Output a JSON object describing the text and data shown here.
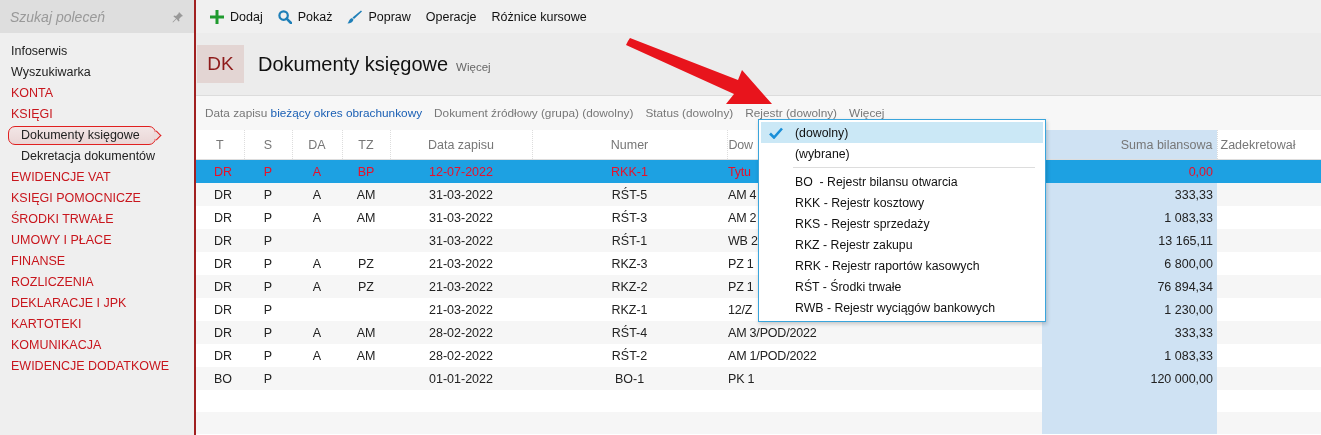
{
  "sidebar": {
    "search": {
      "placeholder": "Szukaj poleceń"
    },
    "items": [
      {
        "label": "Infoserwis",
        "kind": "link",
        "selected": false
      },
      {
        "label": "Wyszukiwarka",
        "kind": "link",
        "selected": false
      },
      {
        "label": "KONTA",
        "kind": "section",
        "selected": false
      },
      {
        "label": "KSIĘGI",
        "kind": "section",
        "selected": false
      },
      {
        "label": "Dokumenty księgowe",
        "kind": "subitem",
        "selected": true
      },
      {
        "label": "Dekretacja dokumentów",
        "kind": "subitem",
        "selected": false
      },
      {
        "label": "EWIDENCJE VAT",
        "kind": "section",
        "selected": false
      },
      {
        "label": "KSIĘGI POMOCNICZE",
        "kind": "section",
        "selected": false
      },
      {
        "label": "ŚRODKI TRWAŁE",
        "kind": "section",
        "selected": false
      },
      {
        "label": "UMOWY I PŁACE",
        "kind": "section",
        "selected": false
      },
      {
        "label": "FINANSE",
        "kind": "section",
        "selected": false
      },
      {
        "label": "ROZLICZENIA",
        "kind": "section",
        "selected": false
      },
      {
        "label": "DEKLARACJE I JPK",
        "kind": "section",
        "selected": false
      },
      {
        "label": "KARTOTEKI",
        "kind": "section",
        "selected": false
      },
      {
        "label": "KOMUNIKACJA",
        "kind": "section",
        "selected": false
      },
      {
        "label": "EWIDENCJE DODATKOWE",
        "kind": "section",
        "selected": false
      }
    ]
  },
  "toolbar": [
    {
      "label": "Dodaj"
    },
    {
      "label": "Pokaż"
    },
    {
      "label": "Popraw"
    },
    {
      "label": "Operacje"
    },
    {
      "label": "Różnice kursowe"
    }
  ],
  "header": {
    "badge": "DK",
    "title": "Dokumenty księgowe",
    "more": "Więcej"
  },
  "filters": [
    {
      "label": "Data zapisu",
      "value": "bieżący okres obrachunkowy"
    },
    {
      "label": "Dokument źródłowy (grupa) (dowolny)"
    },
    {
      "label": "Status (dowolny)"
    },
    {
      "label": "Rejestr (dowolny)"
    },
    {
      "label": "Więcej"
    }
  ],
  "table": {
    "columns": [
      "T",
      "S",
      "DA",
      "TZ",
      "Data zapisu",
      "Numer",
      "Dow",
      "Suma bilansowa",
      "Zadekretował"
    ],
    "rows": [
      {
        "cells": [
          "DR",
          "P",
          "A",
          "BP",
          "12-07-2022",
          "RKK-1",
          "Tytu",
          "0,00",
          ""
        ],
        "selected": true
      },
      {
        "cells": [
          "DR",
          "P",
          "A",
          "AM",
          "31-03-2022",
          "RŚT-5",
          "AM 4",
          "333,33",
          ""
        ],
        "selected": false
      },
      {
        "cells": [
          "DR",
          "P",
          "A",
          "AM",
          "31-03-2022",
          "RŚT-3",
          "AM 2",
          "1 083,33",
          ""
        ],
        "selected": false
      },
      {
        "cells": [
          "DR",
          "P",
          "",
          "",
          "31-03-2022",
          "RŚT-1",
          "WB 2",
          "13 165,11",
          ""
        ],
        "selected": false
      },
      {
        "cells": [
          "DR",
          "P",
          "A",
          "PZ",
          "21-03-2022",
          "RKZ-3",
          "PZ 1",
          "6 800,00",
          ""
        ],
        "selected": false
      },
      {
        "cells": [
          "DR",
          "P",
          "A",
          "PZ",
          "21-03-2022",
          "RKZ-2",
          "PZ 1",
          "76 894,34",
          ""
        ],
        "selected": false
      },
      {
        "cells": [
          "DR",
          "P",
          "",
          "",
          "21-03-2022",
          "RKZ-1",
          "12/Z",
          "1 230,00",
          ""
        ],
        "selected": false
      },
      {
        "cells": [
          "DR",
          "P",
          "A",
          "AM",
          "28-02-2022",
          "RŚT-4",
          "AM 3/POD/2022",
          "333,33",
          ""
        ],
        "selected": false
      },
      {
        "cells": [
          "DR",
          "P",
          "A",
          "AM",
          "28-02-2022",
          "RŚT-2",
          "AM 1/POD/2022",
          "1 083,33",
          ""
        ],
        "selected": false
      },
      {
        "cells": [
          "BO",
          "P",
          "",
          "",
          "01-01-2022",
          "BO-1",
          "PK 1",
          "120 000,00",
          ""
        ],
        "selected": false
      }
    ]
  },
  "dropdown": {
    "items": [
      {
        "kind": "option",
        "label": "(dowolny)",
        "selected": true
      },
      {
        "kind": "option",
        "label": "(wybrane)",
        "selected": false
      },
      {
        "kind": "divider"
      },
      {
        "kind": "option",
        "label": "BO  - Rejestr bilansu otwarcia",
        "selected": false
      },
      {
        "kind": "option",
        "label": "RKK - Rejestr kosztowy",
        "selected": false
      },
      {
        "kind": "option",
        "label": "RKS - Rejestr sprzedaży",
        "selected": false
      },
      {
        "kind": "option",
        "label": "RKZ - Rejestr zakupu",
        "selected": false
      },
      {
        "kind": "option",
        "label": "RRK - Rejestr raportów kasowych",
        "selected": false
      },
      {
        "kind": "option",
        "label": "RŚT - Środki trwałe",
        "selected": false
      },
      {
        "kind": "option",
        "label": "RWB - Rejestr wyciągów bankowych",
        "selected": false
      }
    ]
  }
}
